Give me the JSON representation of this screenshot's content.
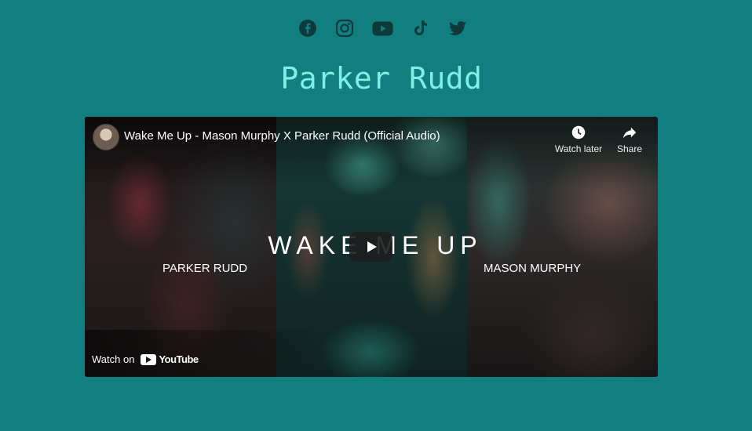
{
  "social": [
    {
      "icon": "facebook-icon"
    },
    {
      "icon": "instagram-icon"
    },
    {
      "icon": "youtube-icon"
    },
    {
      "icon": "tiktok-icon"
    },
    {
      "icon": "twitter-icon"
    }
  ],
  "page": {
    "title": "Parker Rudd"
  },
  "video": {
    "title": "Wake Me Up - Mason Murphy X Parker Rudd (Official Audio)",
    "watch_later_label": "Watch later",
    "share_label": "Share",
    "overlay_text": "WAKE ME UP",
    "artist_left": "PARKER RUDD",
    "artist_right": "MASON MURPHY",
    "watch_on_label": "Watch on",
    "youtube_wordmark": "YouTube"
  },
  "colors": {
    "background": "#117f7f",
    "title": "#7ff0e6",
    "social_icons": "#0e3a3b"
  }
}
